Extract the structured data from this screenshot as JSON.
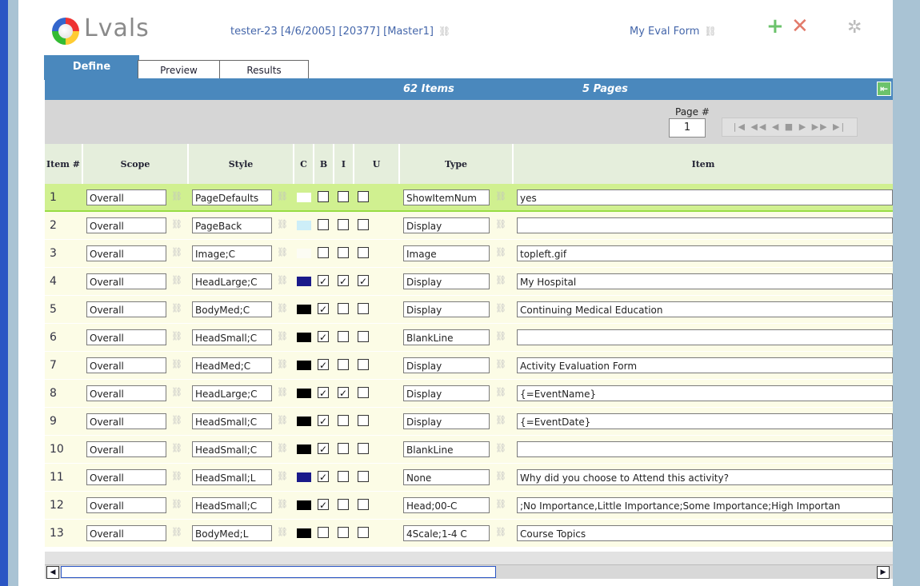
{
  "header": {
    "logo_text": "Lvals",
    "session": "tester-23 [4/6/2005] [20377] [Master1]",
    "form_name": "My Eval Form"
  },
  "tabs": [
    {
      "label": "Define",
      "active": true
    },
    {
      "label": "Preview",
      "active": false
    },
    {
      "label": "Results",
      "active": false
    }
  ],
  "summary": {
    "items": "62 Items",
    "pages": "5 Pages"
  },
  "pager": {
    "label": "Page #",
    "value": "1",
    "nav": "|◀ ◀◀ ◀  ■  ▶ ▶▶ ▶|"
  },
  "columns": {
    "num": "Item #",
    "scope": "Scope",
    "style": "Style",
    "color": "C",
    "bold": "B",
    "italic": "I",
    "underline": "U",
    "type": "Type",
    "item": "Item"
  },
  "colors": {
    "accent": "#4a88bd",
    "selected_row": "#d0f090",
    "navy": "#1a1a8a"
  },
  "rows": [
    {
      "num": "1",
      "scope": "Overall",
      "style": "PageDefaults",
      "color": "#ffffff",
      "b": false,
      "i": false,
      "u": false,
      "type": "ShowItemNum",
      "item": "yes"
    },
    {
      "num": "2",
      "scope": "Overall",
      "style": "PageBack",
      "color": "#cdeef8",
      "b": false,
      "i": false,
      "u": false,
      "type": "Display",
      "item": ""
    },
    {
      "num": "3",
      "scope": "Overall",
      "style": "Image;C",
      "color": "#fcfcf4",
      "b": false,
      "i": false,
      "u": false,
      "type": "Image",
      "item": "topleft.gif"
    },
    {
      "num": "4",
      "scope": "Overall",
      "style": "HeadLarge;C",
      "color": "#1a1a8a",
      "b": true,
      "i": true,
      "u": true,
      "type": "Display",
      "item": "My Hospital"
    },
    {
      "num": "5",
      "scope": "Overall",
      "style": "BodyMed;C",
      "color": "#000000",
      "b": true,
      "i": false,
      "u": false,
      "type": "Display",
      "item": "Continuing Medical Education"
    },
    {
      "num": "6",
      "scope": "Overall",
      "style": "HeadSmall;C",
      "color": "#000000",
      "b": true,
      "i": false,
      "u": false,
      "type": "BlankLine",
      "item": ""
    },
    {
      "num": "7",
      "scope": "Overall",
      "style": "HeadMed;C",
      "color": "#000000",
      "b": true,
      "i": false,
      "u": false,
      "type": "Display",
      "item": "Activity Evaluation Form"
    },
    {
      "num": "8",
      "scope": "Overall",
      "style": "HeadLarge;C",
      "color": "#000000",
      "b": true,
      "i": true,
      "u": false,
      "type": "Display",
      "item": "{=EventName}"
    },
    {
      "num": "9",
      "scope": "Overall",
      "style": "HeadSmall;C",
      "color": "#000000",
      "b": true,
      "i": false,
      "u": false,
      "type": "Display",
      "item": "{=EventDate}"
    },
    {
      "num": "10",
      "scope": "Overall",
      "style": "HeadSmall;C",
      "color": "#000000",
      "b": true,
      "i": false,
      "u": false,
      "type": "BlankLine",
      "item": ""
    },
    {
      "num": "11",
      "scope": "Overall",
      "style": "HeadSmall;L",
      "color": "#1a1a8a",
      "b": true,
      "i": false,
      "u": false,
      "type": "None",
      "item": "Why did you choose to Attend this activity?"
    },
    {
      "num": "12",
      "scope": "Overall",
      "style": "HeadSmall;C",
      "color": "#000000",
      "b": true,
      "i": false,
      "u": false,
      "type": "Head;00-C",
      "item": ";No Importance,Little Importance;Some Importance;High Importan"
    },
    {
      "num": "13",
      "scope": "Overall",
      "style": "BodyMed;L",
      "color": "#000000",
      "b": false,
      "i": false,
      "u": false,
      "type": "4Scale;1-4 C",
      "item": "Course Topics"
    }
  ]
}
